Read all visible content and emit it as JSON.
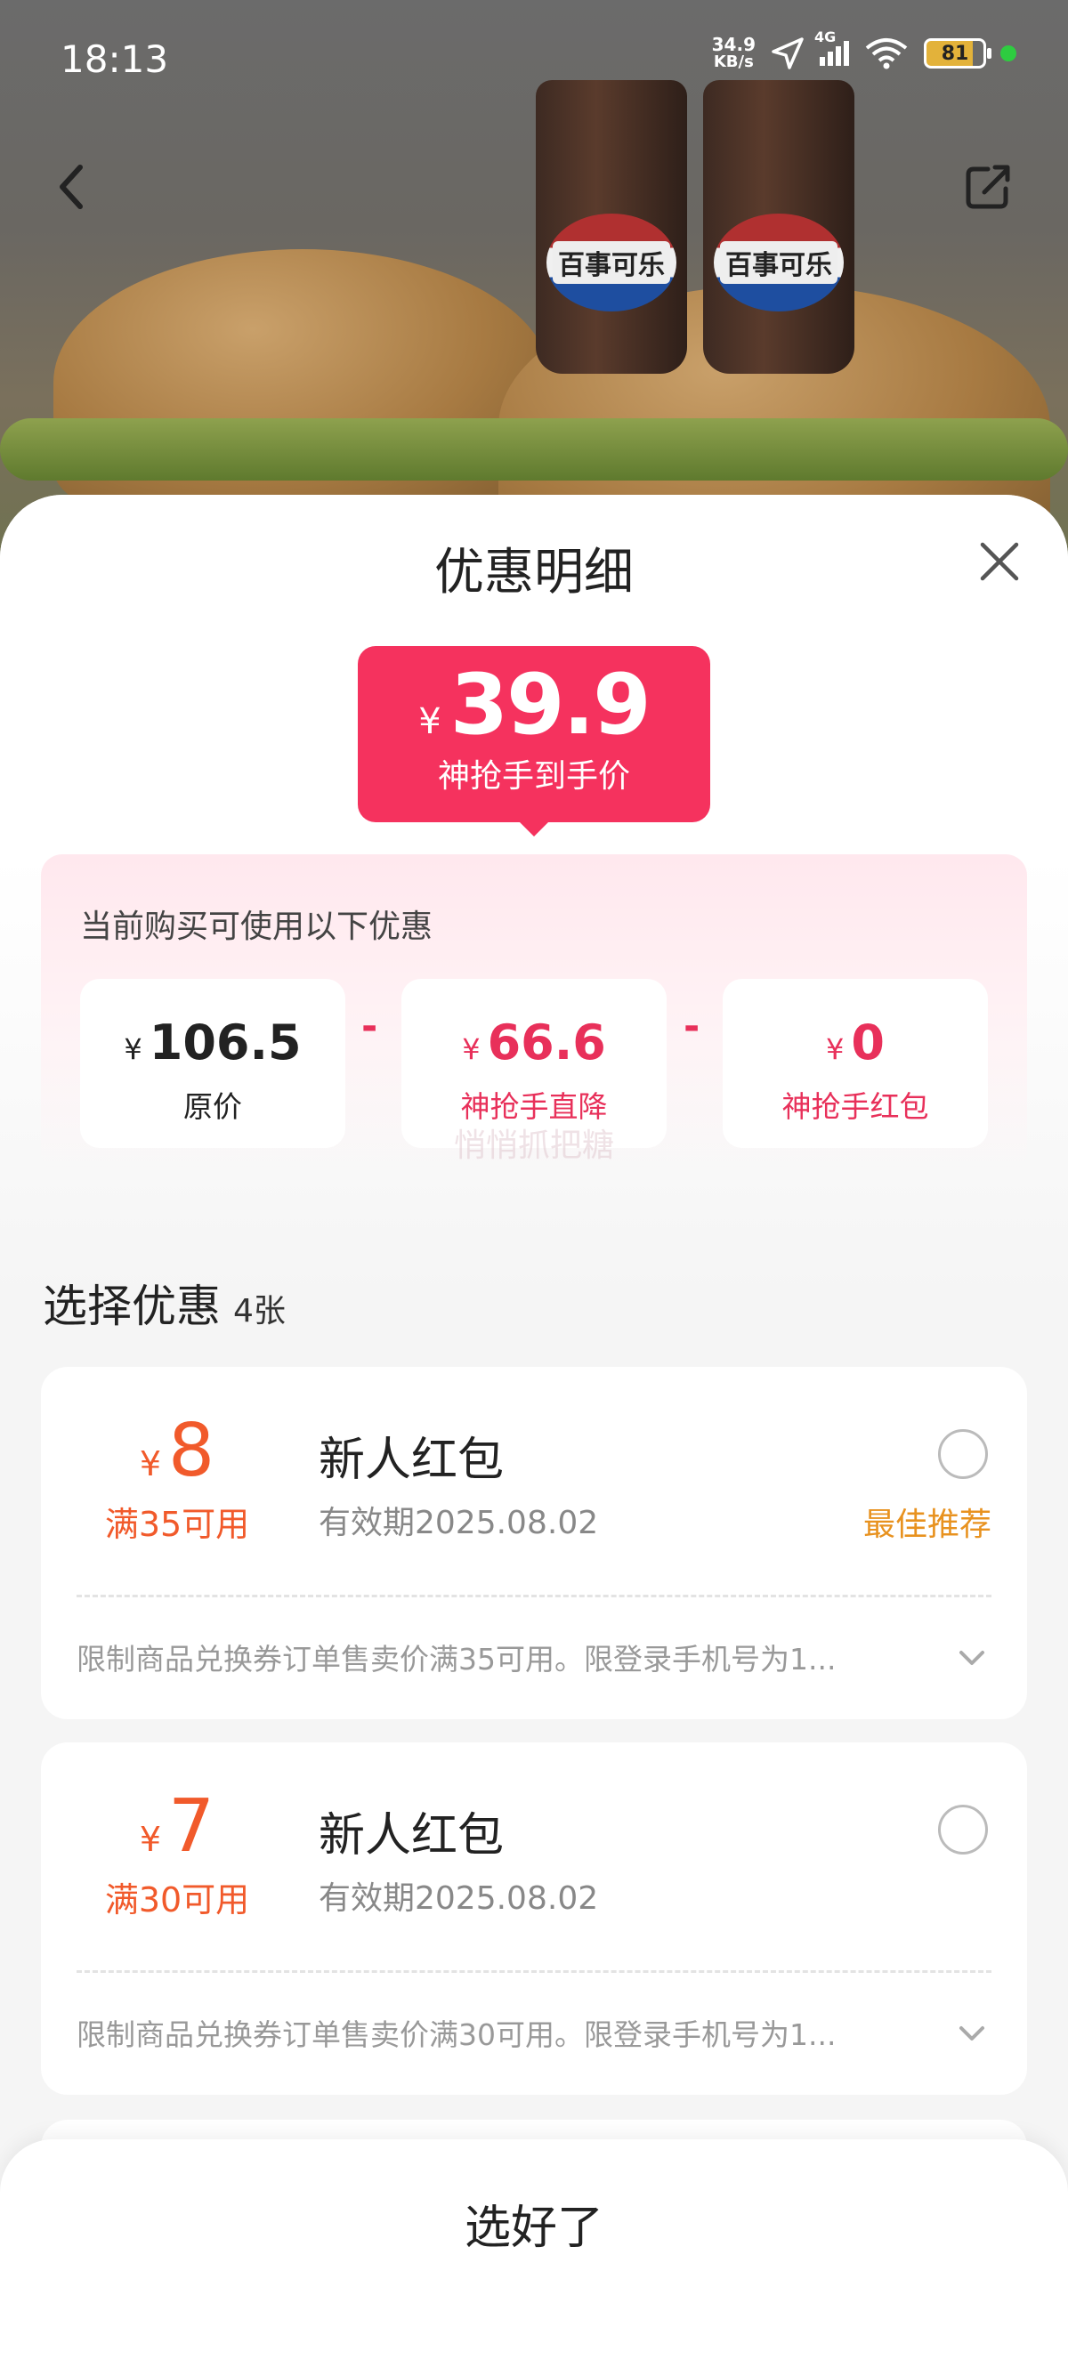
{
  "status_bar": {
    "time": "18:13",
    "net_speed_value": "34.9",
    "net_speed_unit": "KB/s",
    "network": "4G",
    "battery": "81"
  },
  "sheet": {
    "title": "优惠明细",
    "final_price": {
      "symbol": "¥",
      "value": "39.9",
      "label": "神抢手到手价"
    },
    "breakdown": {
      "title": "当前购买可使用以下优惠",
      "items": [
        {
          "symbol": "¥",
          "value": "106.5",
          "label": "原价"
        },
        {
          "symbol": "¥",
          "value": "66.6",
          "label": "神抢手直降"
        },
        {
          "symbol": "¥",
          "value": "0",
          "label": "神抢手红包"
        }
      ],
      "operator": "-"
    },
    "watermark": "悄悄抓把糖",
    "select": {
      "title": "选择优惠",
      "count": "4张"
    },
    "coupons": [
      {
        "symbol": "¥",
        "amount": "8",
        "condition": "满35可用",
        "name": "新人红包",
        "validity": "有效期2025.08.02",
        "recommend": "最佳推荐",
        "description": "限制商品兑换券订单售卖价满35可用。限登录手机号为1..."
      },
      {
        "symbol": "¥",
        "amount": "7",
        "condition": "满30可用",
        "name": "新人红包",
        "validity": "有效期2025.08.02",
        "recommend": "",
        "description": "限制商品兑换券订单售卖价满30可用。限登录手机号为1..."
      }
    ],
    "done_button": "选好了"
  },
  "hero": {
    "cup_logo_text": "百事可乐"
  },
  "colors": {
    "price_badge": "#f5325e",
    "discount_red": "#e8305a",
    "coupon_orange": "#f15a2b",
    "recommend_orange": "#e8921f"
  },
  "icons": [
    "back-arrow-icon",
    "share-icon",
    "close-icon",
    "location-arrow-icon",
    "signal-icon",
    "wifi-icon",
    "battery-icon",
    "chevron-down-icon"
  ]
}
